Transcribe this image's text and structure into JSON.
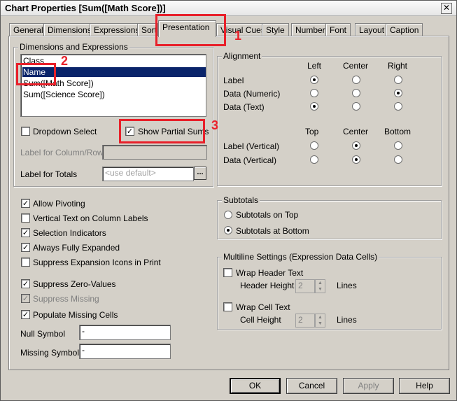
{
  "window": {
    "title": "Chart Properties [Sum([Math Score])]",
    "close_glyph": "✕"
  },
  "tabs": [
    "General",
    "Dimensions",
    "Expressions",
    "Sort",
    "Presentation",
    "Visual Cues",
    "Style",
    "Number",
    "Font",
    "Layout",
    "Caption"
  ],
  "active_tab": "Presentation",
  "dims": {
    "label": "Dimensions and Expressions",
    "items": [
      "Class",
      "Name",
      "Sum([Math Score])",
      "Sum([Science Score])"
    ],
    "selected": "Name",
    "dropdown_select": "Dropdown Select",
    "show_partial_sums": "Show Partial Sums",
    "label_col_row": "Label for Column/Row",
    "label_totals": "Label for Totals",
    "totals_placeholder": "<use default>",
    "ellipsis": "..."
  },
  "alignment": {
    "label": "Alignment",
    "h_cols": [
      "Left",
      "Center",
      "Right"
    ],
    "h_rows": [
      "Label",
      "Data (Numeric)",
      "Data (Text)"
    ],
    "v_cols": [
      "Top",
      "Center",
      "Bottom"
    ],
    "v_rows": [
      "Label (Vertical)",
      "Data (Vertical)"
    ]
  },
  "options": {
    "allow_pivoting": "Allow Pivoting",
    "vertical_text": "Vertical Text on Column Labels",
    "selection_indicators": "Selection Indicators",
    "always_expanded": "Always Fully Expanded",
    "suppress_expansion": "Suppress Expansion Icons in Print",
    "suppress_zero": "Suppress Zero-Values",
    "suppress_missing": "Suppress Missing",
    "populate_missing": "Populate Missing Cells",
    "null_symbol": "Null Symbol",
    "null_value": "-",
    "missing_symbol": "Missing Symbol",
    "missing_value": "-"
  },
  "subtotals": {
    "label": "Subtotals",
    "top": "Subtotals on Top",
    "bottom": "Subtotals at Bottom"
  },
  "multiline": {
    "label": "Multiline Settings (Expression Data Cells)",
    "wrap_header": "Wrap Header Text",
    "header_height": "Header Height",
    "header_value": "2",
    "wrap_cell": "Wrap Cell Text",
    "cell_height": "Cell Height",
    "cell_value": "2",
    "lines": "Lines"
  },
  "buttons": {
    "ok": "OK",
    "cancel": "Cancel",
    "apply": "Apply",
    "help": "Help"
  },
  "annotations": [
    "1",
    "2",
    "3"
  ],
  "colors": {
    "selection": "#0a246a",
    "annotation": "#e8202a",
    "dialog_bg": "#d4d0c8"
  }
}
